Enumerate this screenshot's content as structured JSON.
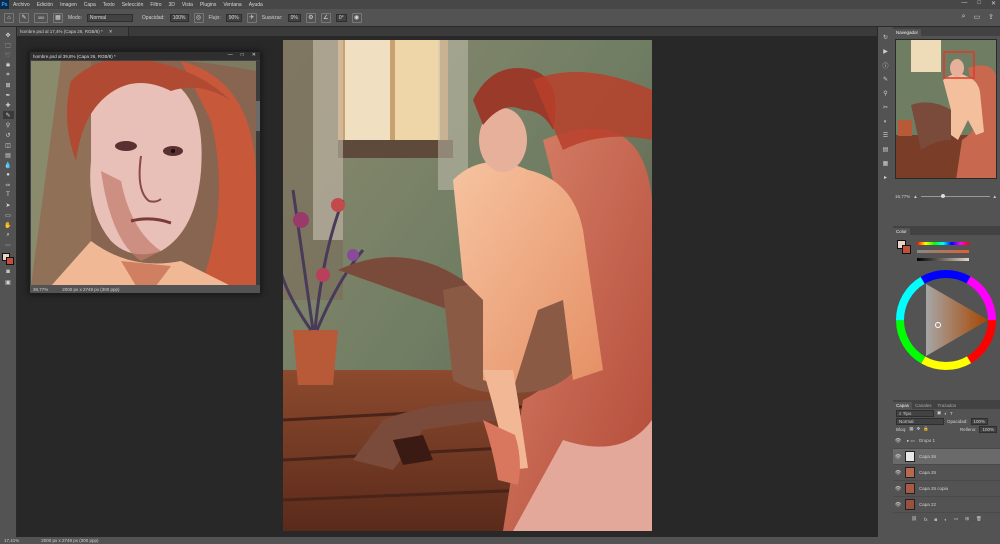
{
  "menubar": {
    "logo": "Ps",
    "items": [
      "Archivo",
      "Edición",
      "Imagen",
      "Capa",
      "Texto",
      "Selección",
      "Filtro",
      "3D",
      "Vista",
      "Plugins",
      "Ventana",
      "Ayuda"
    ],
    "window_controls": [
      "—",
      "□",
      "✕"
    ]
  },
  "options_bar": {
    "brush_size": "300",
    "mode_label": "Modo:",
    "mode_value": "Normal",
    "opacity_label": "Opacidad:",
    "opacity_value": "100%",
    "flow_label": "Flujo:",
    "flow_value": "90%",
    "smoothing_label": "Suavizar:",
    "smoothing_value": "0%",
    "angle_value": "0°",
    "search_icon": "⌕",
    "workspace_icon": "▭",
    "share_icon": "⇪"
  },
  "document": {
    "tab_title": "hombre.psd al 17,4% (Capa 26, RGB/8) *"
  },
  "float_window": {
    "title": "hombre.psd al 39,8% (Capa 26, RGB/8) *",
    "zoom": "38,77%",
    "dimensions": "2000 px x 2749 px (300 ppp)"
  },
  "status_bar": {
    "zoom": "17,41%",
    "dimensions": "2000 px x 2749 px (300 ppp)"
  },
  "panels": {
    "navigator_tab": "Navegador",
    "navigator_zoom": "16,77%",
    "color_tab": "Color",
    "layers_tabs": [
      "Capas",
      "Canales",
      "Trazados"
    ],
    "layers_filter": "Tipo",
    "blend_mode": "Normal",
    "opacity_label": "Opacidad:",
    "opacity_value": "100%",
    "lock_label": "Bloq:",
    "fill_label": "Relleno:",
    "fill_value": "100%",
    "layers": [
      {
        "name": "Grupo 1",
        "selected": false
      },
      {
        "name": "Capa 26",
        "selected": true
      },
      {
        "name": "Capa 25",
        "selected": false
      },
      {
        "name": "Capa 25 copia",
        "selected": false
      },
      {
        "name": "Capa 22",
        "selected": false
      }
    ]
  },
  "tools": [
    "move-tool",
    "artboard-tool",
    "lasso-tool",
    "quick-select-tool",
    "crop-tool",
    "eyedropper-tool",
    "healing-brush-tool",
    "brush-tool",
    "clone-stamp-tool",
    "history-brush-tool",
    "eraser-tool",
    "gradient-tool",
    "blur-tool",
    "dodge-tool",
    "pen-tool",
    "type-tool",
    "path-select-tool",
    "rectangle-tool",
    "hand-tool",
    "zoom-tool"
  ],
  "colors": {
    "app_bg": "#535353",
    "canvas_bg": "#282828",
    "accent_orange": "#e07040",
    "skin": "#f0b090"
  }
}
